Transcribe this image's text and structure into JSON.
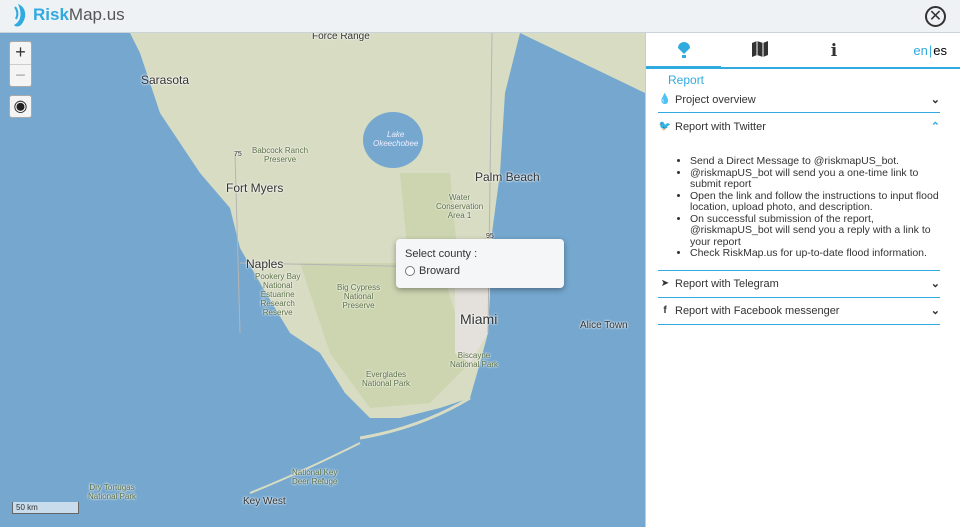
{
  "header": {
    "logo_bold": "Risk",
    "logo_rest": "Map.us",
    "close_icon": "close-circle-icon"
  },
  "map": {
    "zoom_in": "+",
    "zoom_out": "−",
    "scale": "50 km",
    "labels": {
      "force_range": "Force Range",
      "sarasota": "Sarasota",
      "babcock": "Babcock Ranch\nPreserve",
      "fort_myers": "Fort Myers",
      "lake": "Lake\nOkeechobee",
      "palm_beach": "Palm Beach",
      "water": "Water\nConservation\nArea 1",
      "naples": "Naples",
      "pookery": "Pookery Bay\nNational\nEstuarine\nResearch\nReserve",
      "big_cypress": "Big Cypress\nNational\nPreserve",
      "miami": "Miami",
      "alice": "Alice Town",
      "biscayne": "Biscayne\nNational Park",
      "everglades": "Everglades\nNational Park",
      "key_deer": "National Key\nDeer Refuge",
      "tortugas": "Dry Tortugas\nNational Park",
      "key_west": "Key West",
      "i75": "75",
      "i95": "95"
    },
    "popup": {
      "title": "Select county :",
      "option": "Broward"
    }
  },
  "panel": {
    "tabs": [
      "report",
      "map",
      "info"
    ],
    "lang_en": "en",
    "lang_sep": "|",
    "lang_es": "es",
    "report_title": "Report",
    "sections": [
      {
        "label": "Project overview",
        "icon": "drop-icon"
      },
      {
        "label": "Report with Twitter",
        "icon": "twitter-icon"
      },
      {
        "label": "Report with Telegram",
        "icon": "telegram-icon"
      },
      {
        "label": "Report with Facebook messenger",
        "icon": "facebook-icon"
      }
    ],
    "twitter_steps": [
      "Send a Direct Message to @riskmapUS_bot.",
      "@riskmapUS_bot will send you a one-time link to submit report",
      "Open the link and follow the instructions to input flood location, upload photo, and description.",
      "On successful submission of the report, @riskmapUS_bot will send you a reply with a link to your report",
      "Check RiskMap.us for up-to-date flood information."
    ]
  },
  "colors": {
    "accent": "#31aadf",
    "water": "#75a7cf",
    "land": "#d8dcc3"
  }
}
